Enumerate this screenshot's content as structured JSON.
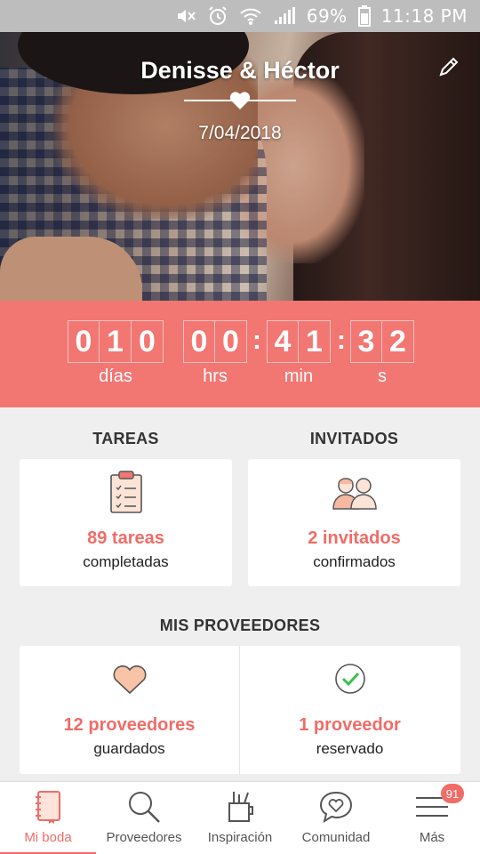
{
  "status_bar": {
    "battery_percent": "69%",
    "time": "11:18 PM",
    "icons": [
      "mute-icon",
      "alarm-icon",
      "wifi-icon",
      "signal-icon",
      "battery-icon"
    ]
  },
  "hero": {
    "couple_names": "Denisse & Héctor",
    "wedding_date": "7/04/2018",
    "divider_icon": "heart-icon",
    "edit_icon": "pencil-icon"
  },
  "countdown": {
    "days": [
      "0",
      "1",
      "0"
    ],
    "hours": [
      "0",
      "0"
    ],
    "minutes": [
      "4",
      "1"
    ],
    "seconds": [
      "3",
      "2"
    ],
    "separator": ":",
    "labels": {
      "days": "días",
      "hours": "hrs",
      "minutes": "min",
      "seconds": "s"
    }
  },
  "tasks": {
    "title": "TAREAS",
    "count": "89 tareas",
    "sub": "completadas",
    "icon": "clipboard-icon"
  },
  "guests": {
    "title": "INVITADOS",
    "count": "2 invitados",
    "sub": "confirmados",
    "icon": "guests-icon"
  },
  "vendors": {
    "title": "MIS PROVEEDORES",
    "saved": {
      "count": "12 proveedores",
      "sub": "guardados",
      "icon": "heart-icon"
    },
    "booked": {
      "count": "1 proveedor",
      "sub": "reservado",
      "icon": "check-circle-icon"
    }
  },
  "bottom_nav": {
    "items": [
      {
        "label": "Mi boda",
        "icon": "notebook-icon",
        "active": true
      },
      {
        "label": "Proveedores",
        "icon": "search-icon"
      },
      {
        "label": "Inspiración",
        "icon": "pencil-cup-icon"
      },
      {
        "label": "Comunidad",
        "icon": "chat-heart-icon"
      },
      {
        "label": "Más",
        "icon": "menu-icon",
        "badge": "91"
      }
    ]
  },
  "colors": {
    "accent": "#f27672",
    "text": "#333333",
    "background": "#efefef"
  }
}
